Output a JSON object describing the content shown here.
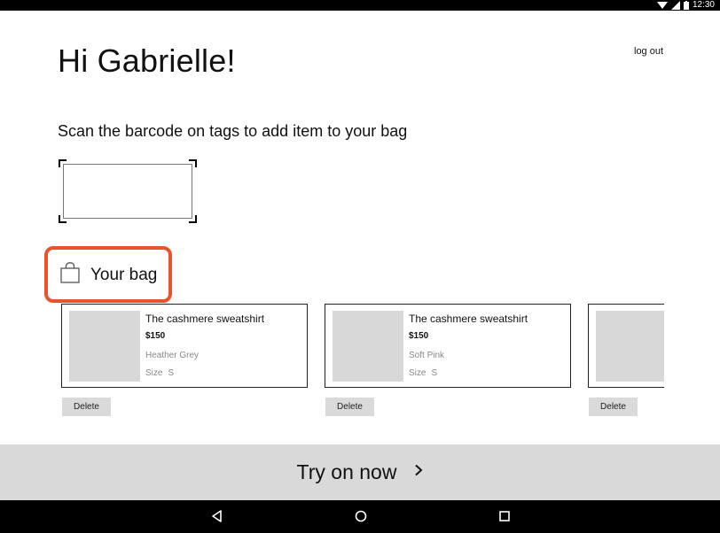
{
  "status_bar": {
    "time": "12:30",
    "icons": [
      "wifi-icon",
      "signal-icon",
      "battery-icon"
    ]
  },
  "header": {
    "greeting": "Hi Gabrielle!",
    "logout_label": "log out"
  },
  "scan": {
    "instruction": "Scan the barcode on tags to add item to your bag"
  },
  "bag": {
    "heading": "Your bag",
    "icon": "shopping-bag-icon",
    "highlight_color": "#e8532e",
    "items": [
      {
        "name": "The cashmere sweatshirt",
        "price": "$150",
        "color": "Heather Grey",
        "size_label": "Size",
        "size": "S",
        "delete_label": "Delete"
      },
      {
        "name": "The cashmere sweatshirt",
        "price": "$150",
        "color": "Soft Pink",
        "size_label": "Size",
        "size": "S",
        "delete_label": "Delete"
      },
      {
        "name": "",
        "price": "",
        "color": "",
        "size_label": "",
        "size": "",
        "delete_label": "Delete"
      }
    ]
  },
  "cta": {
    "label": "Try on now",
    "icon": "chevron-right-icon"
  },
  "nav": {
    "buttons": [
      "back-icon",
      "home-icon",
      "recents-icon"
    ]
  }
}
